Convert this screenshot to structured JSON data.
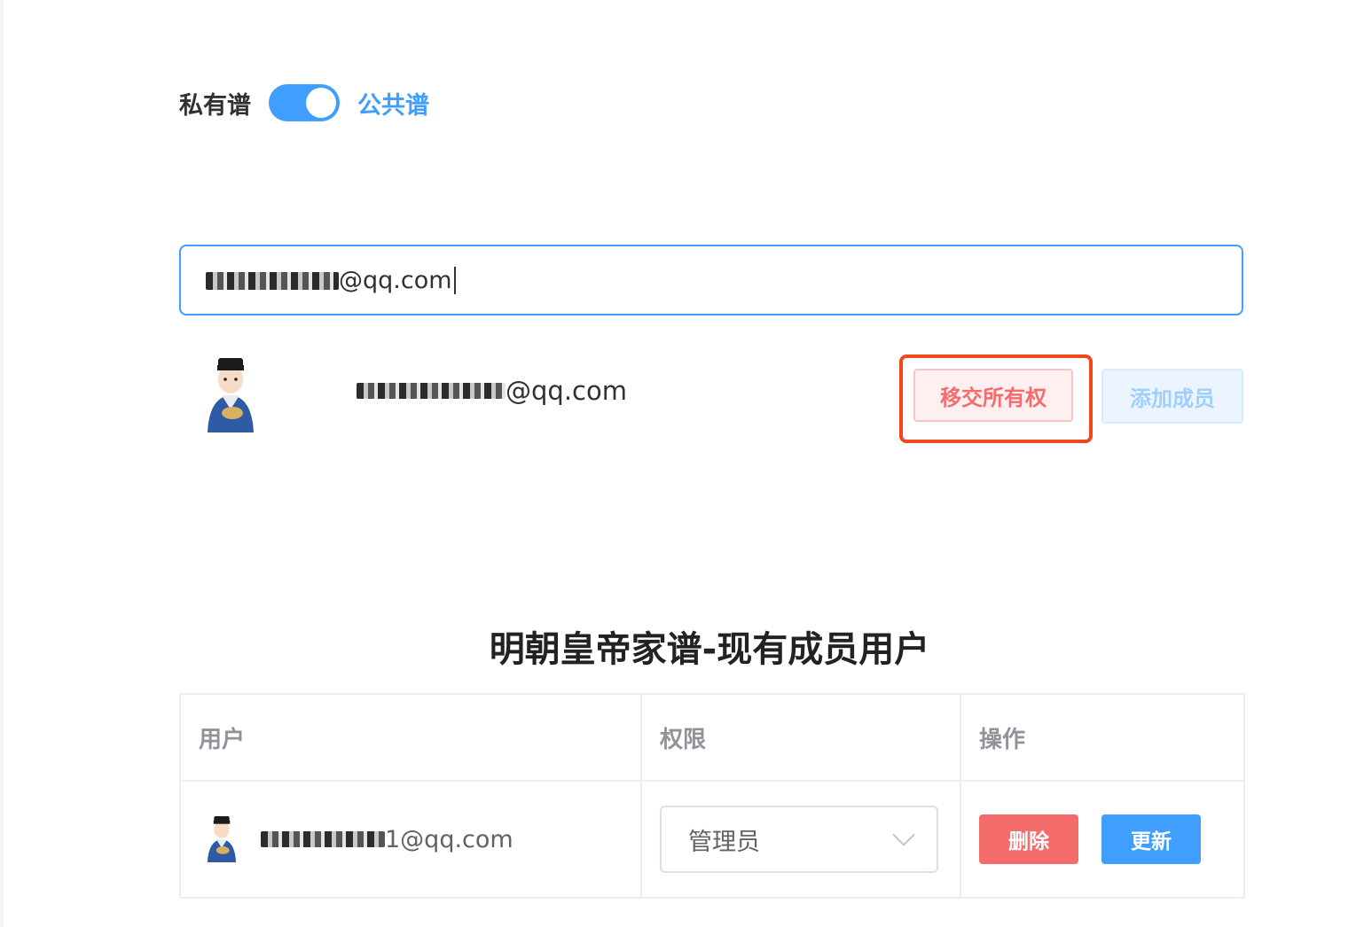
{
  "visibility": {
    "private_label": "私有谱",
    "public_label": "公共谱",
    "is_public": true
  },
  "search": {
    "value_suffix": "@qq.com"
  },
  "result": {
    "email_suffix": "@qq.com",
    "transfer_label": "移交所有权",
    "add_label": "添加成员"
  },
  "section": {
    "title": "明朝皇帝家谱-现有成员用户"
  },
  "table": {
    "headers": [
      "用户",
      "权限",
      "操作"
    ],
    "rows": [
      {
        "email_suffix": "1@qq.com",
        "role": "管理员",
        "delete_label": "删除",
        "update_label": "更新"
      }
    ]
  },
  "colors": {
    "primary": "#409eff",
    "danger": "#f56c6c",
    "highlight_border": "#f2471b"
  }
}
